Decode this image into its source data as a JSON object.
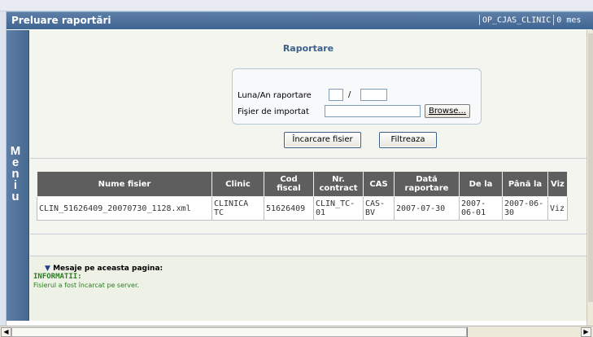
{
  "header": {
    "title": "Preluare raportări",
    "user": "OP_CJAS_CLINIC",
    "messages": "0 mes"
  },
  "menu": {
    "letters": [
      "M",
      "e",
      "n",
      "i",
      "u"
    ]
  },
  "report": {
    "section_title": "Raportare",
    "month_year_label": "Luna/An raportare",
    "month_value": "",
    "year_value": "",
    "separator": "/",
    "file_label": "Fişier de importat",
    "file_value": "",
    "browse_label": "Browse...",
    "load_button": "Încarcare fisier",
    "filter_button": "Filtreaza"
  },
  "table": {
    "columns": [
      "Nume fisier",
      "Clinic",
      "Cod fiscal",
      "Nr. contract",
      "CAS",
      "Dată raportare",
      "De la",
      "Până la",
      "Viz"
    ],
    "rows": [
      [
        "CLIN_51626409_20070730_1128.xml",
        "CLINICA TC",
        "51626409",
        "CLIN_TC-01",
        "CAS-BV",
        "2007-07-30",
        "2007-06-01",
        "2007-06-30",
        "Viz"
      ]
    ]
  },
  "messages": {
    "header": "Mesaje pe aceasta pagina:",
    "info_label": "INFORMATII:",
    "info_text": "Fisierul a fost încarcat pe server."
  },
  "colors": {
    "title_bar": "#4a6f99",
    "table_header": "#5e5e5e",
    "info_green": "#2a7d1f",
    "link_blue": "#3a5f8a"
  }
}
